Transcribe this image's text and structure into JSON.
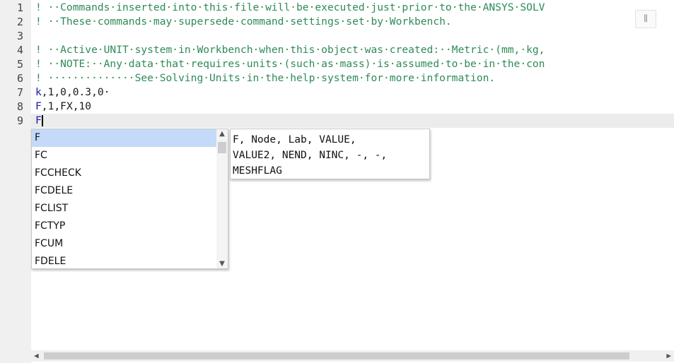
{
  "lines": [
    {
      "num": "1",
      "segments": [
        {
          "cls": "comment",
          "text": "! ··Commands·inserted·into·this·file·will·be·executed·just·prior·to·the·ANSYS·SOLV"
        }
      ]
    },
    {
      "num": "2",
      "segments": [
        {
          "cls": "comment",
          "text": "! ··These·commands·may·supersede·command·settings·set·by·Workbench."
        }
      ]
    },
    {
      "num": "3",
      "segments": []
    },
    {
      "num": "4",
      "segments": [
        {
          "cls": "comment",
          "text": "! ··Active·UNIT·system·in·Workbench·when·this·object·was·created:··Metric·(mm,·kg,"
        }
      ]
    },
    {
      "num": "5",
      "segments": [
        {
          "cls": "comment",
          "text": "! ··NOTE:··Any·data·that·requires·units·(such·as·mass)·is·assumed·to·be·in·the·con"
        }
      ]
    },
    {
      "num": "6",
      "segments": [
        {
          "cls": "comment",
          "text": "! ··············See·Solving·Units·in·the·help·system·for·more·information."
        }
      ]
    },
    {
      "num": "7",
      "segments": [
        {
          "cls": "kw",
          "text": "k"
        },
        {
          "cls": "plain",
          "text": ",1,0,0.3,0·"
        }
      ]
    },
    {
      "num": "8",
      "segments": [
        {
          "cls": "kw",
          "text": "F"
        },
        {
          "cls": "plain",
          "text": ",1,FX,10"
        }
      ]
    },
    {
      "num": "9",
      "segments": [
        {
          "cls": "kw",
          "text": "F"
        }
      ]
    }
  ],
  "autocomplete": {
    "items": [
      "F",
      "FC",
      "FCCHECK",
      "FCDELE",
      "FCLIST",
      "FCTYP",
      "FCUM",
      "FDELE"
    ],
    "selected_index": 0
  },
  "hint": {
    "text": "F, Node, Lab, VALUE,\nVALUE2, NEND, NINC, -, -,\nMESHFLAG"
  },
  "icons": {
    "scroll_up": "▲",
    "scroll_down": "▼",
    "scroll_left": "◀",
    "scroll_right": "▶",
    "minimap": "⫼"
  }
}
